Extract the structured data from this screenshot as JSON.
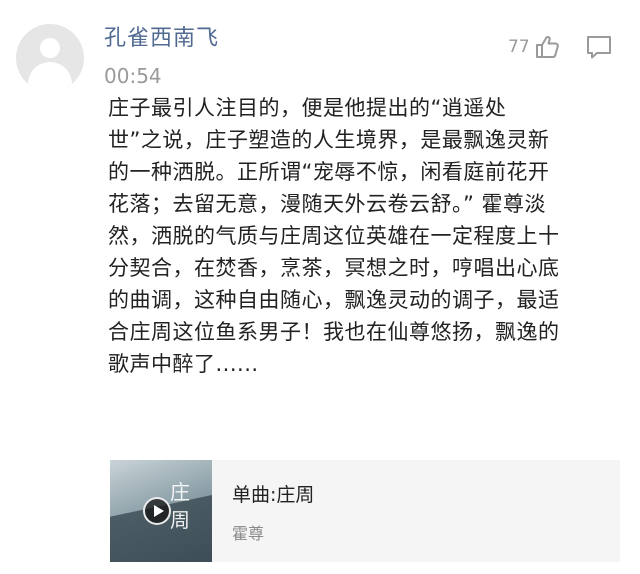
{
  "comment": {
    "username": "孔雀西南飞",
    "time": "00:54",
    "like_count": "77",
    "lines": [
      "庄子最引人注目的，便是他提出的“逍遥处",
      "世”之说，庄子塑造的人生境界，是最飘逸灵新",
      "的一种洒脱。正所谓“宠辱不惊，闲看庭前花开",
      "花落；去留无意，漫随天外云卷云舒。” 霍尊淡",
      "然，洒脱的气质与庄周这位英雄在一定程度上十",
      "分契合，在焚香，烹茶，冥想之时，哼唱出心底",
      "的曲调，这种自由随心，飘逸灵动的调子，最适",
      "合庄周这位鱼系男子！我也在仙尊悠扬，飘逸的",
      "歌声中醉了......"
    ]
  },
  "music": {
    "title": "单曲:庄周",
    "artist": "霍尊",
    "cover_text": "庄周"
  },
  "icons": {
    "like": "thumbs-up-icon",
    "comment": "comment-icon",
    "play": "play-icon"
  },
  "colors": {
    "username": "#506a92",
    "meta": "#9a9a9a",
    "text": "#222222",
    "card_bg": "#f5f5f5"
  }
}
